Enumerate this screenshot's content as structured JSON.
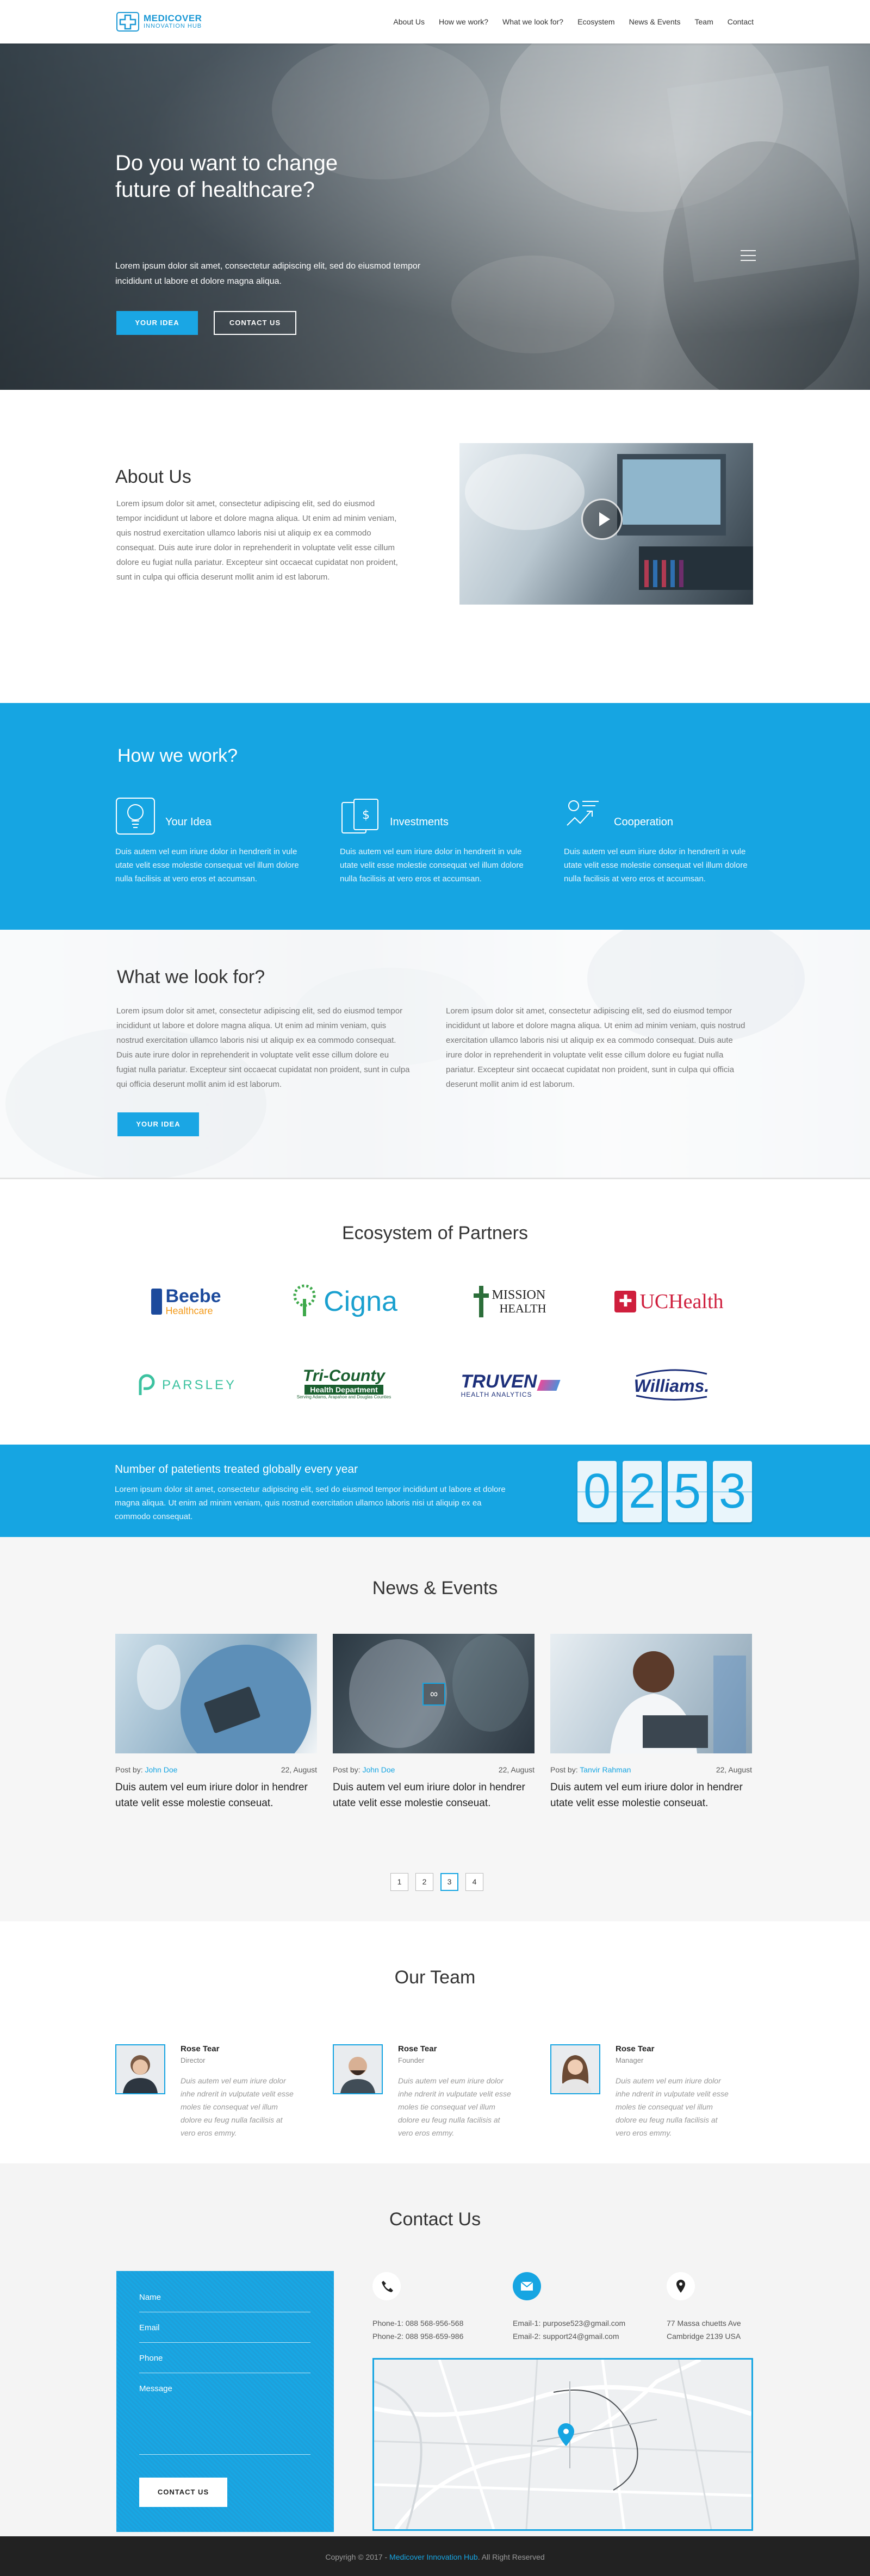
{
  "header": {
    "logo_line1": "MEDICOVER",
    "logo_line2": "INNOVATION HUB",
    "nav": [
      "About Us",
      "How we work?",
      "What we look for?",
      "Ecosystem",
      "News & Events",
      "Team",
      "Contact"
    ]
  },
  "hero": {
    "title": "Do you want to change future of healthcare?",
    "text": "Lorem ipsum dolor sit amet, consectetur adipiscing elit, sed do eiusmod tempor incididunt ut labore et dolore magna aliqua.",
    "primary_button": "YOUR IDEA",
    "secondary_button": "CONTACT US"
  },
  "about": {
    "title": "About Us",
    "text": "Lorem ipsum dolor sit amet, consectetur adipiscing elit, sed do eiusmod tempor incididunt ut labore et dolore magna aliqua. Ut enim ad minim veniam, quis nostrud exercitation ullamco laboris nisi ut aliquip ex ea commodo consequat. Duis aute irure dolor in reprehenderit in voluptate velit esse cillum dolore eu fugiat nulla pariatur. Excepteur sint occaecat cupidatat non proident, sunt in culpa qui officia deserunt mollit anim id est laborum."
  },
  "how": {
    "title": "How we work?",
    "items": [
      {
        "title": "Your Idea",
        "text": "Duis autem vel eum iriure dolor in hendrerit in vule utate velit esse molestie consequat vel illum dolore nulla facilisis at vero eros et accumsan."
      },
      {
        "title": "Investments",
        "text": "Duis autem vel eum iriure dolor in hendrerit in vule utate velit esse molestie consequat vel illum dolore nulla facilisis at vero eros et accumsan."
      },
      {
        "title": "Cooperation",
        "text": "Duis autem vel eum iriure dolor in hendrerit in vule utate velit esse molestie consequat vel illum dolore nulla facilisis at vero eros et accumsan."
      }
    ]
  },
  "look": {
    "title": "What we look for?",
    "col1": "Lorem ipsum dolor sit amet, consectetur adipiscing elit, sed do eiusmod tempor incididunt ut labore et dolore magna aliqua. Ut enim ad minim veniam, quis nostrud exercitation ullamco laboris nisi ut aliquip ex ea commodo consequat. Duis aute irure dolor in reprehenderit in voluptate velit esse cillum dolore eu fugiat nulla pariatur. Excepteur sint occaecat cupidatat non proident, sunt in culpa qui officia deserunt mollit anim id est laborum.",
    "col2": "Lorem ipsum dolor sit amet, consectetur adipiscing elit, sed do eiusmod tempor incididunt ut labore et dolore magna aliqua. Ut enim ad minim veniam, quis nostrud exercitation ullamco laboris nisi ut aliquip ex ea commodo consequat. Duis aute irure dolor in reprehenderit in voluptate velit esse cillum dolore eu fugiat nulla pariatur. Excepteur sint occaecat cupidatat non proident, sunt in culpa qui officia deserunt mollit anim id est laborum.",
    "button": "YOUR IDEA"
  },
  "ecosystem": {
    "title": "Ecosystem of Partners",
    "partners": [
      {
        "name": "Beebe",
        "sub": "Healthcare"
      },
      {
        "name": "Cigna"
      },
      {
        "name": "MISSION",
        "sub": "HEALTH"
      },
      {
        "name": "UCHealth"
      },
      {
        "name": "PARSLEY"
      },
      {
        "name": "Tri-County",
        "sub": "Health Department",
        "tagline": "Serving Adams, Arapahoe and Douglas Counties"
      },
      {
        "name": "TRUVEN",
        "sub": "HEALTH ANALYTICS"
      },
      {
        "name": "Williams."
      }
    ]
  },
  "stats": {
    "title": "Number of patetients treated globally every year",
    "text": "Lorem ipsum dolor sit amet, consectetur adipiscing elit, sed do eiusmod tempor incididunt ut labore et dolore magna aliqua. Ut enim ad minim veniam, quis nostrud exercitation ullamco laboris nisi ut aliquip ex ea commodo consequat.",
    "digits": [
      "0",
      "2",
      "5",
      "3"
    ]
  },
  "news": {
    "title": "News & Events",
    "cards": [
      {
        "by": "Post by:",
        "author": "John Doe",
        "date": "22, August",
        "title": "Duis autem vel eum iriure dolor in hendrer utate velit esse molestie conseuat."
      },
      {
        "by": "Post by:",
        "author": "John Doe",
        "date": "22, August",
        "title": "Duis autem vel eum iriure dolor in hendrer utate velit esse molestie conseuat."
      },
      {
        "by": "Post by:",
        "author": "Tanvir Rahman",
        "date": "22, August",
        "title": "Duis autem vel eum iriure dolor in hendrer utate velit esse molestie conseuat."
      }
    ],
    "pages": [
      "1",
      "2",
      "3",
      "4"
    ],
    "current_page": "3"
  },
  "team": {
    "title": "Our Team",
    "members": [
      {
        "name": "Rose Tear",
        "role": "Director",
        "text": "Duis autem vel eum iriure dolor inhe ndrerit in vulputate velit esse moles tie consequat vel illum dolore eu feug nulla facilisis at vero eros emmy."
      },
      {
        "name": "Rose Tear",
        "role": "Founder",
        "text": "Duis autem vel eum iriure dolor inhe ndrerit in vulputate velit esse moles tie consequat vel illum dolore eu feug nulla facilisis at vero eros emmy."
      },
      {
        "name": "Rose Tear",
        "role": "Manager",
        "text": "Duis autem vel eum iriure dolor inhe ndrerit in vulputate velit esse moles tie consequat vel illum dolore eu feug nulla facilisis at vero eros emmy."
      }
    ]
  },
  "contact": {
    "title": "Contact Us",
    "form": {
      "name": "Name",
      "email": "Email",
      "phone": "Phone",
      "message": "Message",
      "button": "CONTACT US"
    },
    "phone1": "Phone-1:  088 568-956-568",
    "phone2": "Phone-2:  088 958-659-986",
    "email1": "Email-1:  purpose523@gmail.com",
    "email2": "Email-2:  support24@gmail.com",
    "address1": "77 Massa chuetts Ave",
    "address2": "Cambridge 2139 USA"
  },
  "footer": {
    "prefix": "Copyrigh © 2017 - ",
    "brand": "Medicover Innovation Hub",
    "suffix": ". All Right Reserved"
  },
  "colors": {
    "accent": "#16a5e2",
    "dark": "#222222"
  }
}
